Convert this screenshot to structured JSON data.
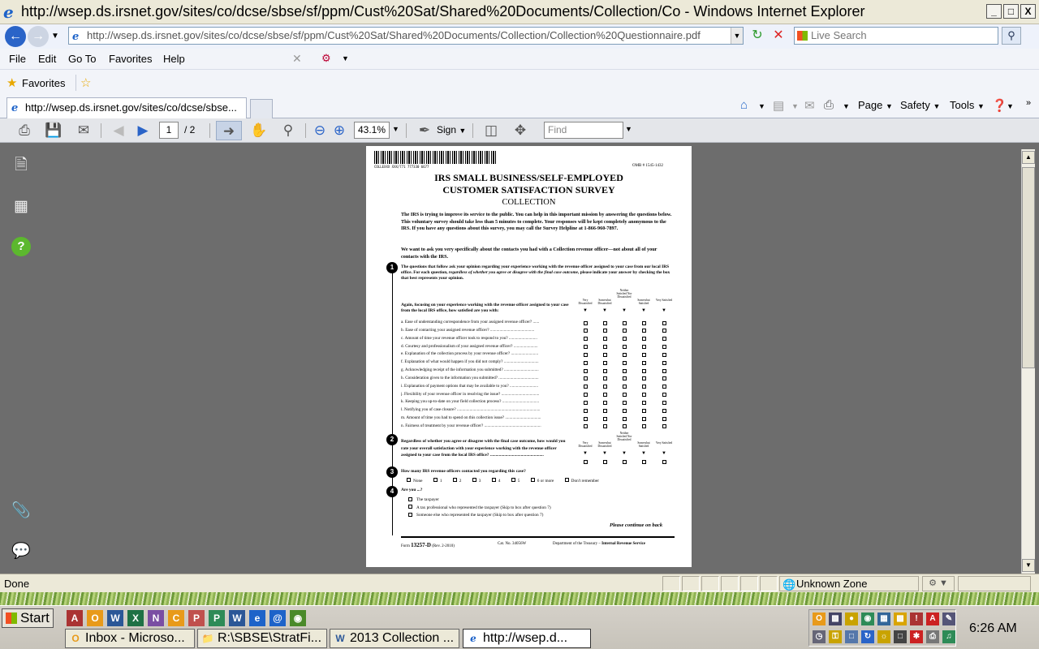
{
  "window": {
    "title": "http://wsep.ds.irsnet.gov/sites/co/dcse/sbse/sf/ppm/Cust%20Sat/Shared%20Documents/Collection/Co - Windows Internet Explorer",
    "min": "_",
    "max": "□",
    "close": "X"
  },
  "address": {
    "url": "http://wsep.ds.irsnet.gov/sites/co/dcse/sbse/sf/ppm/Cust%20Sat/Shared%20Documents/Collection/Collection%20Questionnaire.pdf",
    "search_placeholder": "Live Search"
  },
  "menu": [
    "File",
    "Edit",
    "Go To",
    "Favorites",
    "Help"
  ],
  "favorites": {
    "label": "Favorites"
  },
  "tab": {
    "label": "http://wsep.ds.irsnet.gov/sites/co/dcse/sbse..."
  },
  "commands": {
    "page": "Page",
    "safety": "Safety",
    "tools": "Tools"
  },
  "pdf_toolbar": {
    "page_current": "1",
    "page_total": "/ 2",
    "zoom": "43.1%",
    "sign": "Sign",
    "find_placeholder": "Find"
  },
  "doc": {
    "barcode_id": "COLLEXXX XXX/771 777330 6677",
    "omb": "OMB # 1545-1432",
    "title1": "IRS SMALL BUSINESS/SELF-EMPLOYED",
    "title2": "CUSTOMER SATISFACTION SURVEY",
    "subtitle": "COLLECTION",
    "intro1": "The IRS is trying to improve its service to the public. You can help in this important mission by answering the questions below. This voluntary survey should take less than 5 minutes to complete. Your responses will be kept completely anonymous to the IRS. If you have any questions about this survey, you may call the Survey Helpline at 1-866-960-7897.",
    "intro2": "We want to ask you very specifically about the contacts you had with a Collection revenue officer—not about all of your contacts with the IRS.",
    "q1_num": "1",
    "q1_text_a": "The questions that follow ask your opinion regarding your experience working with the revenue officer assigned to your case from our local IRS office. For each question, ",
    "q1_text_em": "regardless of whether you agree or disagree with the final case outcome",
    "q1_text_b": ", please indicate your answer by checking the box that best represents your opinion.",
    "q1_lead": "Again, focusing on your experience working with the revenue officer assigned to your case from the local IRS office, how satisfied are you with:",
    "scale": [
      "Very Dissatisfied",
      "Somewhat Dissatisfied",
      "Neither Satisfied Nor Dissatisfied",
      "Somewhat Satisfied",
      "Very Satisfied"
    ],
    "items": [
      "a.  Ease of understanding correspondence from your assigned revenue officer? ......",
      "b.  Ease of contacting your assigned revenue officer? ..........................................",
      "c.  Amount of time your revenue officer took to respond to you? ...........................",
      "d.  Courtesy and professionalism of your assigned revenue officer? .......................",
      "e.  Explanation of the collection process by your revenue officer? ..........................",
      "f.  Explanation of what would happen if you did not comply? .................................",
      "g.  Acknowledging receipt of the information you submitted? .................................",
      "h.  Consideration given to the information you submitted? ......................................",
      "i.  Explanation of payment options that may be available to you? ...........................",
      "j.  Flexibility of your revenue officer in resolving the issue? ....................................",
      "k.  Keeping you up-to-date on your field collection process? ...................................",
      "l.  Notifying you of case closure? ...............................................................................",
      "m. Amount of time you had to spend on this collection issue? ..................................",
      "n.  Fairness of treatment by your revenue officer? ......................................................"
    ],
    "q2_num": "2",
    "q2_text": "Regardless of whether you agree or disagree with the final case outcome, how would you rate your overall satisfaction with your experience working with the revenue officer assigned to your case from the local IRS office? .................................................",
    "q3_num": "3",
    "q3_text": "How many IRS revenue officers contacted you regarding this case?",
    "q3_opts": [
      "None",
      "1",
      "2",
      "3",
      "4",
      "5",
      "6 or more",
      "Don't remember"
    ],
    "q4_num": "4",
    "q4_text": "Are you ...?",
    "q4_opts": [
      "The taxpayer",
      "A tax professional who represented the taxpayer (Skip to box after question 7)",
      "Someone else who represented the taxpayer (Skip to box after question 7)"
    ],
    "continue": "Please continue on back",
    "form_prefix": "Form ",
    "form_no": "13257-D",
    "form_rev": " (Rev. 2-2010)",
    "cat_no": "Cat. No. 34056W",
    "dept_a": "Department of the Treasury – ",
    "dept_b": "Internal Revenue Service"
  },
  "status": {
    "text": "Done",
    "zone": "Unknown Zone"
  },
  "taskbar": {
    "start": "Start",
    "tasks": [
      "Inbox - Microso...",
      "R:\\SBSE\\StratFi...",
      "2013 Collection ...",
      "http://wsep.d..."
    ],
    "clock": "6:26 AM"
  }
}
